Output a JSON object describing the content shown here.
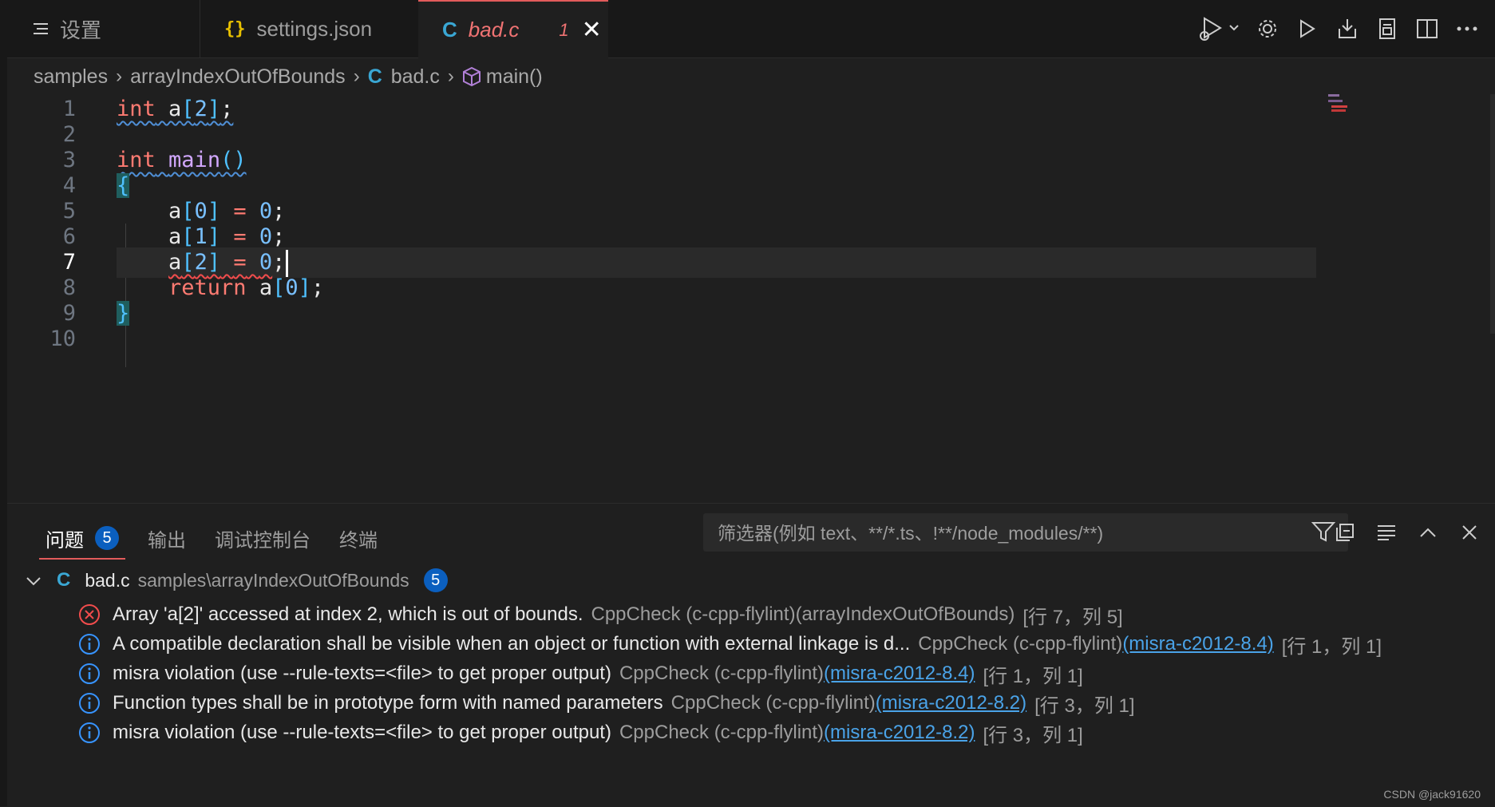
{
  "tabs": {
    "settings": {
      "icon": "list-icon",
      "label": "设置"
    },
    "json": {
      "icon": "{}",
      "label": "settings.json"
    },
    "badc": {
      "icon": "C",
      "label": "bad.c",
      "count": "1"
    }
  },
  "breadcrumb": {
    "items": [
      "samples",
      "arrayIndexOutOfBounds",
      "bad.c",
      "main()"
    ]
  },
  "editor": {
    "line_numbers": [
      "1",
      "2",
      "3",
      "4",
      "5",
      "6",
      "7",
      "8",
      "9",
      "10"
    ],
    "active_line": "7"
  },
  "panel": {
    "tabs": [
      "问题",
      "输出",
      "调试控制台",
      "终端"
    ],
    "problems_count": "5",
    "filter_placeholder": "筛选器(例如 text、**/*.ts、!**/node_modules/**)",
    "group": {
      "icon": "C",
      "file": "bad.c",
      "path": "samples\\arrayIndexOutOfBounds",
      "count": "5"
    },
    "problems": [
      {
        "severity": "error",
        "message": "Array 'a[2]' accessed at index 2, which is out of bounds.",
        "source": "CppCheck (c-cpp-flylint)(arrayIndexOutOfBounds)",
        "link": "",
        "position": "[行 7，列 5]"
      },
      {
        "severity": "info",
        "message": "A compatible declaration shall be visible when an object or function with external linkage is d...",
        "source": "CppCheck (c-cpp-flylint)",
        "link": "(misra-c2012-8.4)",
        "position": "[行 1，列 1]"
      },
      {
        "severity": "info",
        "message": "misra violation (use --rule-texts=<file> to get proper output)",
        "source": "CppCheck (c-cpp-flylint)",
        "link": "(misra-c2012-8.4)",
        "position": "[行 1，列 1]"
      },
      {
        "severity": "info",
        "message": "Function types shall be in prototype form with named parameters",
        "source": "CppCheck (c-cpp-flylint)",
        "link": "(misra-c2012-8.2)",
        "position": "[行 3，列 1]"
      },
      {
        "severity": "info",
        "message": "misra violation (use --rule-texts=<file> to get proper output)",
        "source": "CppCheck (c-cpp-flylint)",
        "link": "(misra-c2012-8.2)",
        "position": "[行 3，列 1]"
      }
    ]
  },
  "watermark": "CSDN @jack91620",
  "colors": {
    "error": "#f14c4c",
    "info": "#3794ff",
    "accent": "#e25b5b",
    "badge": "#0b5fbf"
  }
}
